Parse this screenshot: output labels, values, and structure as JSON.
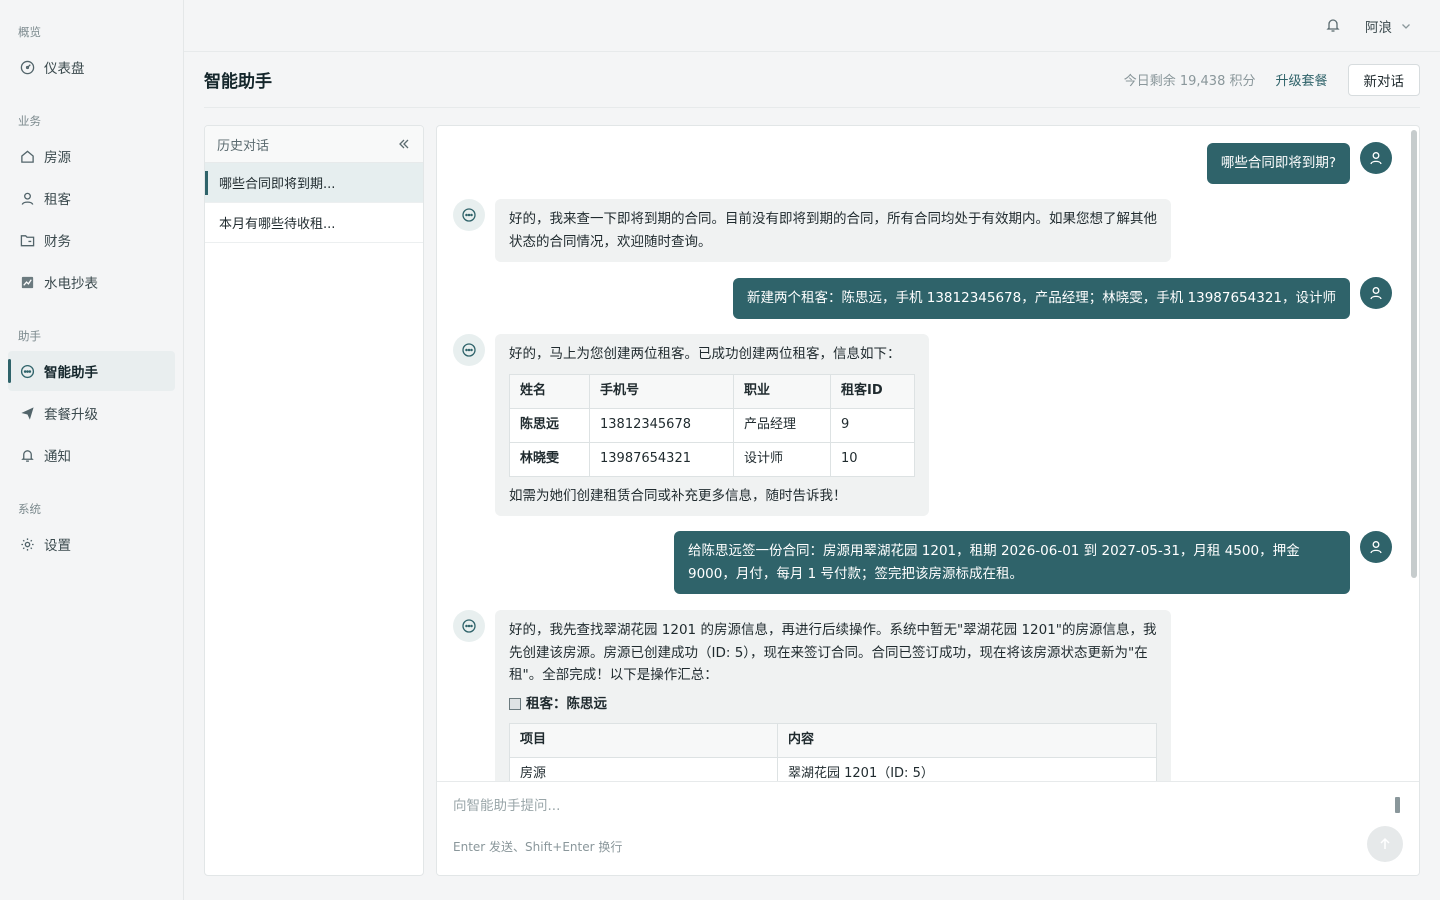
{
  "sidebar": {
    "sections": [
      {
        "label": "概览",
        "items": [
          {
            "label": "仪表盘",
            "icon": "dashboard-icon"
          }
        ]
      },
      {
        "label": "业务",
        "items": [
          {
            "label": "房源",
            "icon": "home-icon"
          },
          {
            "label": "租客",
            "icon": "user-icon"
          },
          {
            "label": "财务",
            "icon": "folder-icon"
          },
          {
            "label": "水电抄表",
            "icon": "chart-icon"
          }
        ]
      },
      {
        "label": "助手",
        "items": [
          {
            "label": "智能助手",
            "icon": "chat-icon",
            "active": true
          },
          {
            "label": "套餐升级",
            "icon": "send-icon"
          },
          {
            "label": "通知",
            "icon": "bell-icon"
          }
        ]
      },
      {
        "label": "系统",
        "items": [
          {
            "label": "设置",
            "icon": "gear-icon"
          }
        ]
      }
    ]
  },
  "topbar": {
    "user_name": "阿浪"
  },
  "header": {
    "title": "智能助手",
    "credits": "今日剩余 19,438 积分",
    "upgrade_label": "升级套餐",
    "new_chat_label": "新对话"
  },
  "history": {
    "title": "历史对话",
    "items": [
      "哪些合同即将到期...",
      "本月有哪些待收租..."
    ]
  },
  "messages": {
    "m1_user": "哪些合同即将到期?",
    "m2_bot": "好的，我来查一下即将到期的合同。目前没有即将到期的合同，所有合同均处于有效期内。如果您想了解其他状态的合同情况，欢迎随时查询。",
    "m3_user": "新建两个租客：陈思远，手机 13812345678，产品经理；林晓雯，手机 13987654321，设计师",
    "m4_bot_intro": "好的，马上为您创建两位租客。已成功创建两位租客，信息如下：",
    "m4_table": {
      "headers": [
        "姓名",
        "手机号",
        "职业",
        "租客ID"
      ],
      "rows": [
        [
          "陈思远",
          "13812345678",
          "产品经理",
          "9"
        ],
        [
          "林晓雯",
          "13987654321",
          "设计师",
          "10"
        ]
      ]
    },
    "m4_bot_outro": "如需为她们创建租赁合同或补充更多信息，随时告诉我！",
    "m5_user": "给陈思远签一份合同：房源用翠湖花园 1201，租期 2026-06-01 到 2027-05-31，月租 4500，押金 9000，月付，每月 1 号付款；签完把该房源标成在租。",
    "m6_bot_intro": "好的，我先查找翠湖花园 1201 的房源信息，再进行后续操作。系统中暂无\"翠湖花园 1201\"的房源信息，我先创建该房源。房源已创建成功（ID: 5），现在来签订合同。合同已签订成功，现在将该房源状态更新为\"在租\"。全部完成！以下是操作汇总：",
    "m6_subtitle": "租客：陈思远",
    "m6_table": {
      "headers": [
        "项目",
        "内容"
      ],
      "rows": [
        [
          "房源",
          "翠湖花园 1201（ID: 5）"
        ]
      ]
    }
  },
  "composer": {
    "placeholder": "向智能助手提问...",
    "hint": "Enter 发送、Shift+Enter 换行"
  },
  "colors": {
    "accent": "#2f636a",
    "user_bubble": "#2f636a",
    "bot_bubble": "#f0f2f2"
  }
}
